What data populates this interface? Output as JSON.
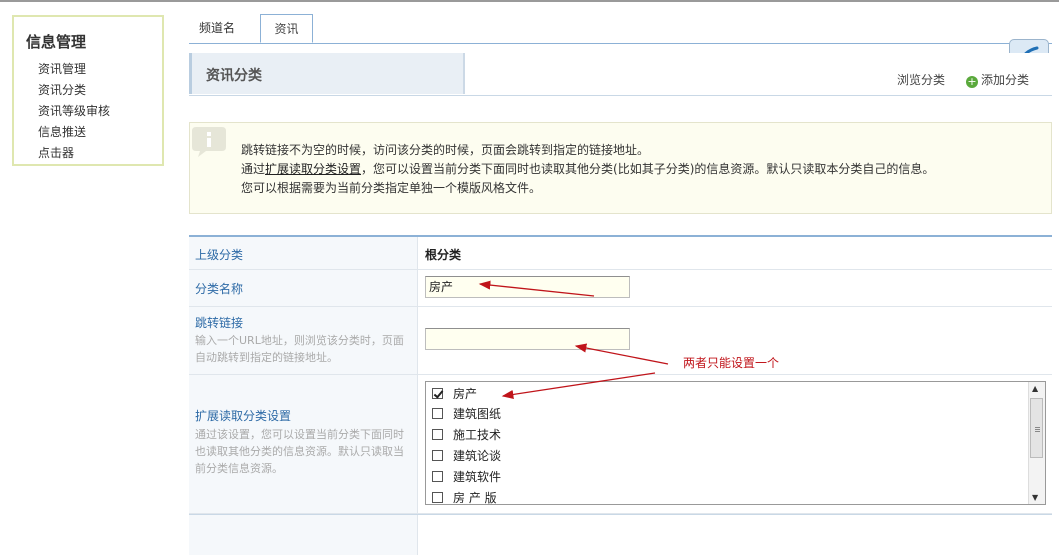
{
  "sidebar": {
    "title": "信息管理",
    "items": [
      {
        "label": "资讯管理"
      },
      {
        "label": "资讯分类"
      },
      {
        "label": "资讯等级审核"
      },
      {
        "label": "信息推送"
      },
      {
        "label": "点击器"
      }
    ]
  },
  "tabs": [
    {
      "label": "频道名",
      "active": false
    },
    {
      "label": "资讯",
      "active": true
    }
  ],
  "header": {
    "title": "资讯分类",
    "browse_label": "浏览分类",
    "add_label": "添加分类"
  },
  "info": {
    "line1": "跳转链接不为空的时候，访问该分类的时候，页面会跳转到指定的链接地址。",
    "line2_prefix": "通过",
    "line2_link": "扩展读取分类设置",
    "line2_suffix": "，您可以设置当前分类下面同时也读取其他分类(比如其子分类)的信息资源。默认只读取本分类自己的信息。",
    "line3": "您可以根据需要为当前分类指定单独一个模版风格文件。"
  },
  "form": {
    "parent": {
      "label": "上级分类",
      "value": "根分类"
    },
    "name": {
      "label": "分类名称",
      "value": "房产"
    },
    "jump": {
      "label": "跳转链接",
      "hint": "输入一个URL地址，则浏览该分类时，页面自动跳转到指定的链接地址。",
      "value": ""
    },
    "extend": {
      "label": "扩展读取分类设置",
      "hint": "通过该设置，您可以设置当前分类下面同时也读取其他分类的信息资源。默认只读取当前分类信息资源。",
      "options": [
        {
          "label": "房产",
          "checked": true
        },
        {
          "label": "建筑图纸",
          "checked": false
        },
        {
          "label": "施工技术",
          "checked": false
        },
        {
          "label": "建筑论谈",
          "checked": false
        },
        {
          "label": "建筑软件",
          "checked": false
        },
        {
          "label": "房 产 版",
          "checked": false
        }
      ]
    }
  },
  "annotation": "两者只能设置一个",
  "colors": {
    "accent": "#2d6aa6",
    "annotation": "#c0141a",
    "info_bg": "#fdfdf0",
    "sidebar_border": "#dfe7b0"
  }
}
